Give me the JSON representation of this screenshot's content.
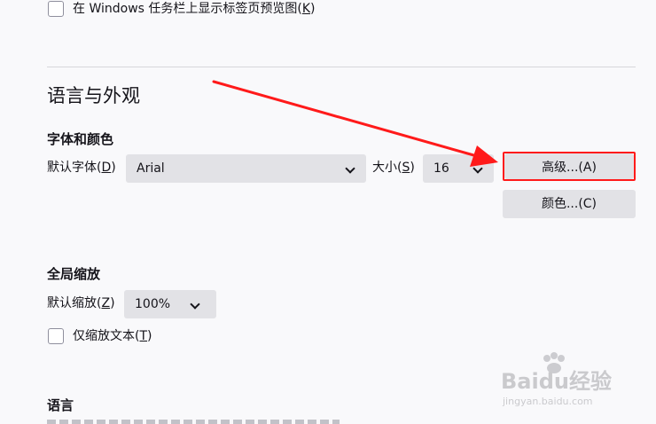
{
  "tabs_option": {
    "label": "在 Windows 任务栏上显示标签页预览图(",
    "accel": "K",
    "suffix": ")",
    "checked": false
  },
  "section_title": "语言与外观",
  "fonts": {
    "heading": "字体和颜色",
    "default_font_label": "默认字体(",
    "default_font_accel": "D",
    "default_font_suffix": ")",
    "default_font_value": "Arial",
    "size_label": "大小(",
    "size_accel": "S",
    "size_suffix": ")",
    "size_value": "16",
    "advanced_button": "高级...(A)",
    "colors_button": "颜色...(C)"
  },
  "zoom": {
    "heading": "全局缩放",
    "default_zoom_label": "默认缩放(",
    "default_zoom_accel": "Z",
    "default_zoom_suffix": ")",
    "default_zoom_value": "100%",
    "text_only_label": "仅缩放文本(",
    "text_only_accel": "T",
    "text_only_suffix": ")",
    "text_only_checked": false
  },
  "language": {
    "heading": "语言"
  },
  "annotation": {
    "color": "#ff1a1a"
  },
  "watermark": {
    "brand": "Baidu经验",
    "url": "jingyan.baidu.com"
  }
}
